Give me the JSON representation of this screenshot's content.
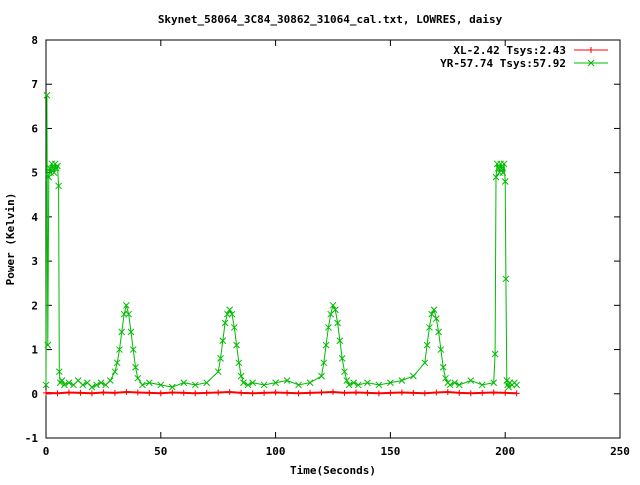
{
  "chart_data": {
    "type": "line",
    "title": "Skynet_58064_3C84_30862_31064_cal.txt, LOWRES, daisy",
    "xlabel": "Time(Seconds)",
    "ylabel": "Power (Kelvin)",
    "xlim": [
      0,
      250
    ],
    "ylim": [
      -1,
      8
    ],
    "x_ticks": [
      0,
      50,
      100,
      150,
      200,
      250
    ],
    "y_ticks": [
      -1,
      0,
      1,
      2,
      3,
      4,
      5,
      6,
      7,
      8
    ],
    "grid": false,
    "legend_position": "top-right",
    "series": [
      {
        "name": "XL-2.42 Tsys:2.43",
        "color": "#ff0000",
        "marker": "plus",
        "x": [
          0,
          5,
          10,
          15,
          20,
          25,
          30,
          35,
          40,
          45,
          50,
          55,
          60,
          65,
          70,
          75,
          80,
          85,
          90,
          95,
          100,
          105,
          110,
          115,
          120,
          125,
          130,
          135,
          140,
          145,
          150,
          155,
          160,
          165,
          170,
          175,
          180,
          185,
          190,
          195,
          200,
          205
        ],
        "y": [
          0.02,
          0.01,
          0.03,
          0.02,
          0.01,
          0.03,
          0.02,
          0.04,
          0.03,
          0.02,
          0.01,
          0.03,
          0.02,
          0.01,
          0.02,
          0.03,
          0.04,
          0.02,
          0.01,
          0.02,
          0.03,
          0.02,
          0.01,
          0.02,
          0.03,
          0.04,
          0.02,
          0.03,
          0.02,
          0.01,
          0.02,
          0.03,
          0.02,
          0.01,
          0.03,
          0.04,
          0.02,
          0.01,
          0.02,
          0.03,
          0.02,
          0.01
        ]
      },
      {
        "name": "YR-57.74 Tsys:57.92",
        "color": "#00bb00",
        "marker": "x",
        "x": [
          0,
          0.4,
          0.8,
          1.2,
          1.6,
          2.0,
          2.5,
          3,
          3.5,
          4,
          4.5,
          5,
          5.5,
          5.8,
          6.2,
          7,
          8,
          10,
          12,
          14,
          16,
          18,
          20,
          22,
          24,
          26,
          28,
          30,
          31,
          32,
          33,
          34,
          35,
          36,
          37,
          38,
          39,
          40,
          42,
          45,
          50,
          55,
          60,
          65,
          70,
          75,
          76,
          77,
          78,
          79,
          80,
          81,
          82,
          83,
          84,
          85,
          86,
          88,
          90,
          95,
          100,
          105,
          110,
          115,
          120,
          121,
          122,
          123,
          124,
          125,
          126,
          127,
          128,
          129,
          130,
          131,
          132,
          134,
          136,
          140,
          145,
          150,
          155,
          160,
          165,
          166,
          167,
          168,
          169,
          170,
          171,
          172,
          173,
          174,
          175,
          176,
          178,
          180,
          185,
          190,
          195,
          195.6,
          196,
          196.5,
          197,
          197.5,
          198,
          198.5,
          199,
          199.5,
          200,
          200.3,
          200.7,
          201,
          201.5,
          202,
          203,
          204,
          205
        ],
        "y": [
          0.2,
          6.75,
          1.1,
          4.9,
          5.1,
          5.0,
          5.2,
          5.1,
          5.0,
          5.2,
          5.1,
          5.15,
          4.7,
          0.5,
          0.25,
          0.3,
          0.2,
          0.25,
          0.2,
          0.3,
          0.2,
          0.25,
          0.15,
          0.2,
          0.25,
          0.2,
          0.3,
          0.5,
          0.7,
          1.0,
          1.4,
          1.8,
          2.0,
          1.8,
          1.4,
          1.0,
          0.6,
          0.35,
          0.2,
          0.25,
          0.2,
          0.15,
          0.25,
          0.2,
          0.25,
          0.5,
          0.8,
          1.2,
          1.6,
          1.8,
          1.9,
          1.8,
          1.5,
          1.1,
          0.7,
          0.4,
          0.25,
          0.2,
          0.25,
          0.2,
          0.25,
          0.3,
          0.2,
          0.25,
          0.4,
          0.7,
          1.1,
          1.5,
          1.8,
          2.0,
          1.9,
          1.6,
          1.2,
          0.8,
          0.5,
          0.3,
          0.2,
          0.25,
          0.2,
          0.25,
          0.2,
          0.25,
          0.3,
          0.4,
          0.7,
          1.1,
          1.5,
          1.8,
          1.9,
          1.7,
          1.4,
          1.0,
          0.6,
          0.35,
          0.25,
          0.2,
          0.25,
          0.2,
          0.3,
          0.2,
          0.25,
          0.9,
          4.9,
          5.2,
          5.1,
          5.0,
          5.2,
          5.1,
          5.0,
          5.2,
          4.8,
          2.6,
          0.3,
          0.2,
          0.15,
          0.25,
          0.2,
          0.25,
          0.2
        ]
      }
    ]
  }
}
